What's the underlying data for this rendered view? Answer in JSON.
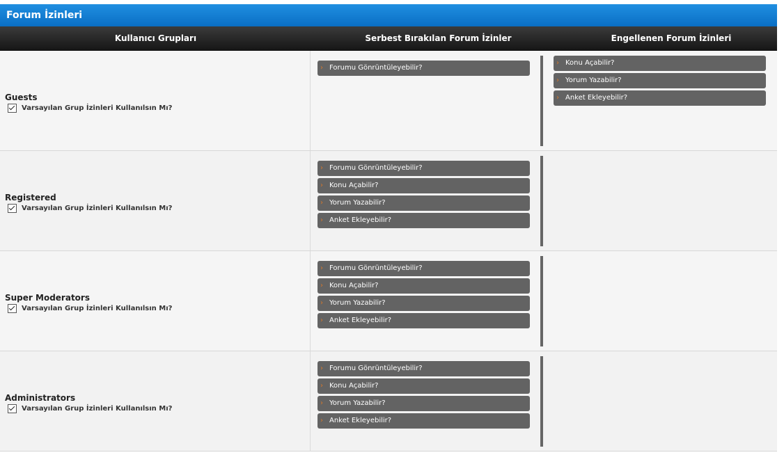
{
  "panel": {
    "title": "Forum İzinleri"
  },
  "headers": {
    "groups": "Kullanıcı Grupları",
    "allowed": "Serbest Bırakılan Forum İzinler",
    "denied": "Engellenen Forum İzinleri"
  },
  "groups": [
    {
      "name": "Guests",
      "default_label": "Varsayılan Grup İzinleri Kullanılsın Mı?",
      "allowed": [
        "Forumu Gönrüntüleyebilir?"
      ],
      "denied": [
        "Konu Açabilir?",
        "Yorum Yazabilir?",
        "Anket Ekleyebilir?"
      ]
    },
    {
      "name": "Registered",
      "default_label": "Varsayılan Grup İzinleri Kullanılsın Mı?",
      "allowed": [
        "Forumu Gönrüntüleyebilir?",
        "Konu Açabilir?",
        "Yorum Yazabilir?",
        "Anket Ekleyebilir?"
      ],
      "denied": []
    },
    {
      "name": "Super Moderators",
      "default_label": "Varsayılan Grup İzinleri Kullanılsın Mı?",
      "allowed": [
        "Forumu Gönrüntüleyebilir?",
        "Konu Açabilir?",
        "Yorum Yazabilir?",
        "Anket Ekleyebilir?"
      ],
      "denied": []
    },
    {
      "name": "Administrators",
      "default_label": "Varsayılan Grup İzinleri Kullanılsın Mı?",
      "allowed": [
        "Forumu Gönrüntüleyebilir?",
        "Konu Açabilir?",
        "Yorum Yazabilir?",
        "Anket Ekleyebilir?"
      ],
      "denied": []
    }
  ],
  "icons": {
    "permission_arrow": "chevron-right-icon",
    "checkbox": "checkbox-checked-icon"
  },
  "colors": {
    "title_bar": "#0a6fc4",
    "header_bar": "#1f1f1f",
    "permission_item": "#636363",
    "arrow": "#d9782a"
  }
}
